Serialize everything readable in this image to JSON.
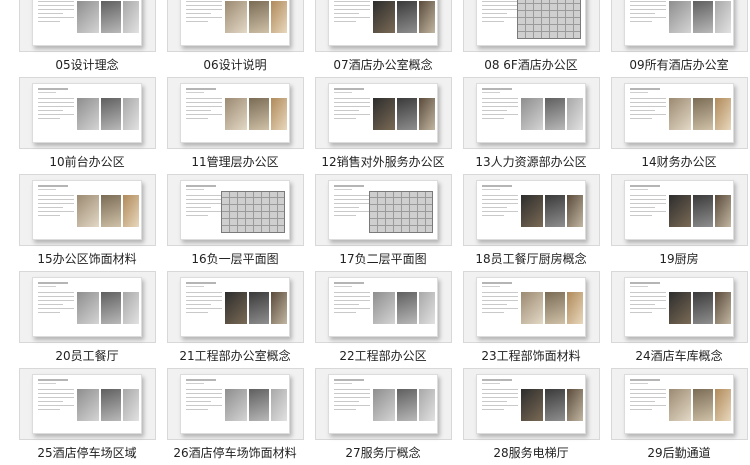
{
  "slides": [
    {
      "label": "05设计理念",
      "style": "photo"
    },
    {
      "label": "06设计说明",
      "style": "warm"
    },
    {
      "label": "07酒店办公室概念",
      "style": "dark"
    },
    {
      "label": "08 6F酒店办公区",
      "style": "plan"
    },
    {
      "label": "09所有酒店办公室",
      "style": "photo"
    },
    {
      "label": "10前台办公区",
      "style": "photo"
    },
    {
      "label": "11管理层办公区",
      "style": "warm"
    },
    {
      "label": "12销售对外服务办公区",
      "style": "dark"
    },
    {
      "label": "13人力资源部办公区",
      "style": "photo"
    },
    {
      "label": "14财务办公区",
      "style": "warm"
    },
    {
      "label": "15办公区饰面材料",
      "style": "warm"
    },
    {
      "label": "16负一层平面图",
      "style": "plan"
    },
    {
      "label": "17负二层平面图",
      "style": "plan"
    },
    {
      "label": "18员工餐厅厨房概念",
      "style": "dark"
    },
    {
      "label": "19厨房",
      "style": "dark"
    },
    {
      "label": "20员工餐厅",
      "style": "photo"
    },
    {
      "label": "21工程部办公室概念",
      "style": "dark"
    },
    {
      "label": "22工程部办公区",
      "style": "photo"
    },
    {
      "label": "23工程部饰面材料",
      "style": "warm"
    },
    {
      "label": "24酒店车库概念",
      "style": "dark"
    },
    {
      "label": "25酒店停车场区域",
      "style": "photo"
    },
    {
      "label": "26酒店停车场饰面材料",
      "style": "photo"
    },
    {
      "label": "27服务厅概念",
      "style": "photo"
    },
    {
      "label": "28服务电梯厅",
      "style": "dark"
    },
    {
      "label": "29后勤通道",
      "style": "warm"
    }
  ]
}
